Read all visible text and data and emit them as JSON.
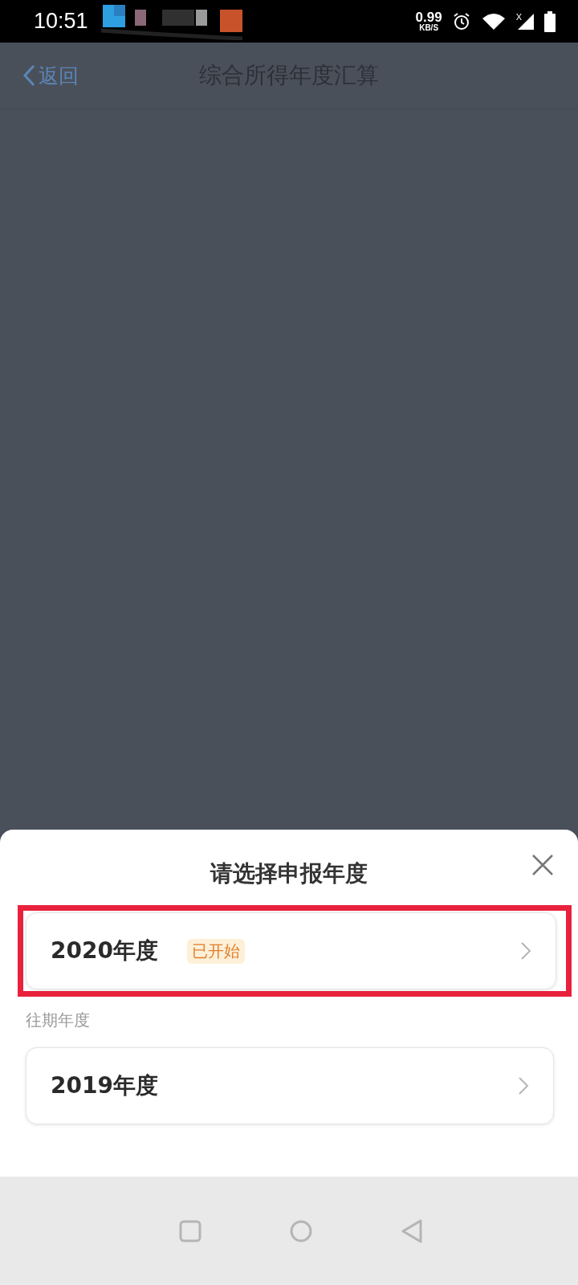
{
  "status_bar": {
    "time": "10:51",
    "speed": "0.99",
    "speed_unit": "KB/S",
    "signal_mark": "X"
  },
  "header": {
    "back": "返回",
    "title": "综合所得年度汇算"
  },
  "sheet": {
    "title": "请选择申报年度",
    "current": [
      {
        "label": "2020年度",
        "badge": "已开始",
        "highlighted": true
      }
    ],
    "section_label": "往期年度",
    "past": [
      {
        "label": "2019年度",
        "highlighted": false
      }
    ]
  }
}
